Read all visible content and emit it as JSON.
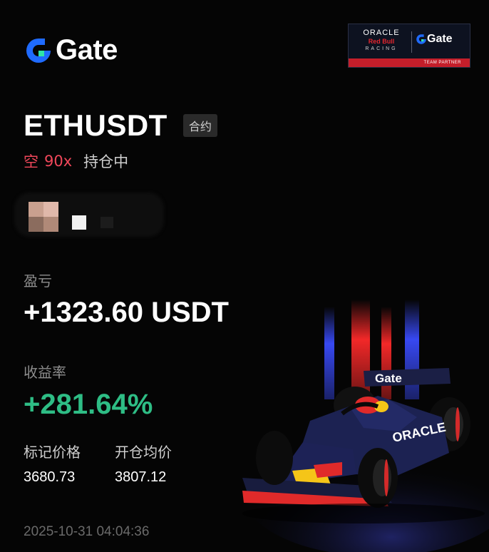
{
  "brand": {
    "name": "Gate",
    "logo_icon": "gate-logo-icon"
  },
  "sponsor": {
    "oracle": "ORACLE",
    "redbull": "Red Bull",
    "racing": "RACING",
    "gate": "Gate",
    "partner": "TEAM PARTNER"
  },
  "position": {
    "pair": "ETHUSDT",
    "type_tag": "合约",
    "direction": "空",
    "leverage": "90x",
    "status": "持仓中"
  },
  "stats": {
    "pnl_label": "盈亏",
    "pnl_value": "+1323.60 USDT",
    "roi_label": "收益率",
    "roi_value": "+281.64%",
    "mark_price_label": "标记价格",
    "mark_price_value": "3680.73",
    "entry_price_label": "开仓均价",
    "entry_price_value": "3807.12"
  },
  "timestamp": "2025-10-31 04:04:36",
  "colors": {
    "background": "#050505",
    "short_red": "#f0475a",
    "profit_green": "#2ebd85",
    "gate_blue": "#1f6bff",
    "label_gray": "#8e8e8e"
  }
}
